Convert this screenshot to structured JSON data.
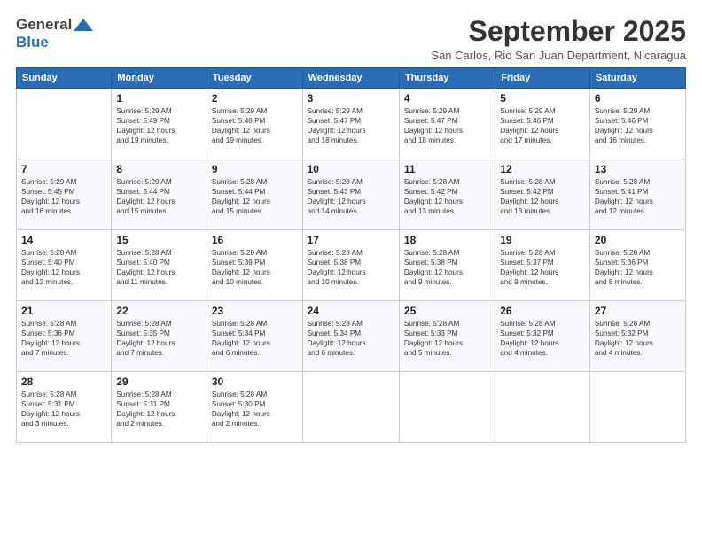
{
  "header": {
    "logo_line1": "General",
    "logo_line2": "Blue",
    "month": "September 2025",
    "location": "San Carlos, Rio San Juan Department, Nicaragua"
  },
  "days_of_week": [
    "Sunday",
    "Monday",
    "Tuesday",
    "Wednesday",
    "Thursday",
    "Friday",
    "Saturday"
  ],
  "weeks": [
    [
      {
        "day": "",
        "info": ""
      },
      {
        "day": "1",
        "info": "Sunrise: 5:29 AM\nSunset: 5:49 PM\nDaylight: 12 hours\nand 19 minutes."
      },
      {
        "day": "2",
        "info": "Sunrise: 5:29 AM\nSunset: 5:48 PM\nDaylight: 12 hours\nand 19 minutes."
      },
      {
        "day": "3",
        "info": "Sunrise: 5:29 AM\nSunset: 5:47 PM\nDaylight: 12 hours\nand 18 minutes."
      },
      {
        "day": "4",
        "info": "Sunrise: 5:29 AM\nSunset: 5:47 PM\nDaylight: 12 hours\nand 18 minutes."
      },
      {
        "day": "5",
        "info": "Sunrise: 5:29 AM\nSunset: 5:46 PM\nDaylight: 12 hours\nand 17 minutes."
      },
      {
        "day": "6",
        "info": "Sunrise: 5:29 AM\nSunset: 5:46 PM\nDaylight: 12 hours\nand 16 minutes."
      }
    ],
    [
      {
        "day": "7",
        "info": "Sunrise: 5:29 AM\nSunset: 5:45 PM\nDaylight: 12 hours\nand 16 minutes."
      },
      {
        "day": "8",
        "info": "Sunrise: 5:29 AM\nSunset: 5:44 PM\nDaylight: 12 hours\nand 15 minutes."
      },
      {
        "day": "9",
        "info": "Sunrise: 5:28 AM\nSunset: 5:44 PM\nDaylight: 12 hours\nand 15 minutes."
      },
      {
        "day": "10",
        "info": "Sunrise: 5:28 AM\nSunset: 5:43 PM\nDaylight: 12 hours\nand 14 minutes."
      },
      {
        "day": "11",
        "info": "Sunrise: 5:28 AM\nSunset: 5:42 PM\nDaylight: 12 hours\nand 13 minutes."
      },
      {
        "day": "12",
        "info": "Sunrise: 5:28 AM\nSunset: 5:42 PM\nDaylight: 12 hours\nand 13 minutes."
      },
      {
        "day": "13",
        "info": "Sunrise: 5:28 AM\nSunset: 5:41 PM\nDaylight: 12 hours\nand 12 minutes."
      }
    ],
    [
      {
        "day": "14",
        "info": "Sunrise: 5:28 AM\nSunset: 5:40 PM\nDaylight: 12 hours\nand 12 minutes."
      },
      {
        "day": "15",
        "info": "Sunrise: 5:28 AM\nSunset: 5:40 PM\nDaylight: 12 hours\nand 11 minutes."
      },
      {
        "day": "16",
        "info": "Sunrise: 5:28 AM\nSunset: 5:39 PM\nDaylight: 12 hours\nand 10 minutes."
      },
      {
        "day": "17",
        "info": "Sunrise: 5:28 AM\nSunset: 5:38 PM\nDaylight: 12 hours\nand 10 minutes."
      },
      {
        "day": "18",
        "info": "Sunrise: 5:28 AM\nSunset: 5:38 PM\nDaylight: 12 hours\nand 9 minutes."
      },
      {
        "day": "19",
        "info": "Sunrise: 5:28 AM\nSunset: 5:37 PM\nDaylight: 12 hours\nand 9 minutes."
      },
      {
        "day": "20",
        "info": "Sunrise: 5:28 AM\nSunset: 5:36 PM\nDaylight: 12 hours\nand 8 minutes."
      }
    ],
    [
      {
        "day": "21",
        "info": "Sunrise: 5:28 AM\nSunset: 5:36 PM\nDaylight: 12 hours\nand 7 minutes."
      },
      {
        "day": "22",
        "info": "Sunrise: 5:28 AM\nSunset: 5:35 PM\nDaylight: 12 hours\nand 7 minutes."
      },
      {
        "day": "23",
        "info": "Sunrise: 5:28 AM\nSunset: 5:34 PM\nDaylight: 12 hours\nand 6 minutes."
      },
      {
        "day": "24",
        "info": "Sunrise: 5:28 AM\nSunset: 5:34 PM\nDaylight: 12 hours\nand 6 minutes."
      },
      {
        "day": "25",
        "info": "Sunrise: 5:28 AM\nSunset: 5:33 PM\nDaylight: 12 hours\nand 5 minutes."
      },
      {
        "day": "26",
        "info": "Sunrise: 5:28 AM\nSunset: 5:32 PM\nDaylight: 12 hours\nand 4 minutes."
      },
      {
        "day": "27",
        "info": "Sunrise: 5:28 AM\nSunset: 5:32 PM\nDaylight: 12 hours\nand 4 minutes."
      }
    ],
    [
      {
        "day": "28",
        "info": "Sunrise: 5:28 AM\nSunset: 5:31 PM\nDaylight: 12 hours\nand 3 minutes."
      },
      {
        "day": "29",
        "info": "Sunrise: 5:28 AM\nSunset: 5:31 PM\nDaylight: 12 hours\nand 2 minutes."
      },
      {
        "day": "30",
        "info": "Sunrise: 5:28 AM\nSunset: 5:30 PM\nDaylight: 12 hours\nand 2 minutes."
      },
      {
        "day": "",
        "info": ""
      },
      {
        "day": "",
        "info": ""
      },
      {
        "day": "",
        "info": ""
      },
      {
        "day": "",
        "info": ""
      }
    ]
  ]
}
